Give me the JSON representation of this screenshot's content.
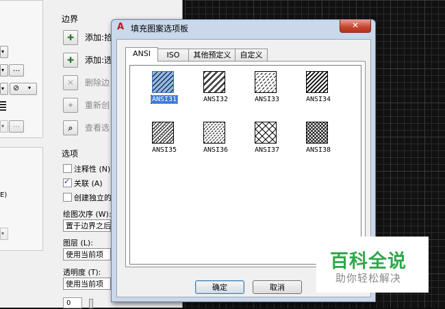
{
  "background_dialog": {
    "boundary_title": "边界",
    "boundary_buttons": [
      {
        "label": "添加:拾",
        "icon": "add-pick-points-icon",
        "enabled": true
      },
      {
        "label": "添加:选",
        "icon": "add-select-objects-icon",
        "enabled": true
      },
      {
        "label": "删除边",
        "icon": "remove-boundaries-icon",
        "enabled": false
      },
      {
        "label": "重新创",
        "icon": "recreate-boundary-icon",
        "enabled": false
      },
      {
        "label": "查看选",
        "icon": "view-selections-icon",
        "enabled": false
      }
    ],
    "options_title": "选项",
    "checkboxes": [
      {
        "label": "注释性 (N)",
        "checked": false
      },
      {
        "label": "关联 (A)",
        "checked": true
      },
      {
        "label": "创建独立的",
        "checked": false
      }
    ],
    "draw_order_label": "绘图次序 (W):",
    "draw_order_value": "置于边界之后",
    "layer_label": "图层 (L):",
    "layer_value": "使用当前项",
    "transparency_label": "透明度 (T):",
    "transparency_value": "使用当前项",
    "transparency_number": "0",
    "left_small_text": "E)",
    "ellipsis": "..."
  },
  "dialog": {
    "title": "填充图案选项板",
    "close_symbol": "✕",
    "tabs": [
      {
        "label": "ANSI",
        "active": true
      },
      {
        "label": "ISO",
        "active": false
      },
      {
        "label": "其他预定义",
        "active": false
      },
      {
        "label": "自定义",
        "active": false
      }
    ],
    "patterns": [
      {
        "name": "ANSI31",
        "selected": true,
        "style": "hatch-diag"
      },
      {
        "name": "ANSI32",
        "selected": false,
        "style": "hatch-diag-double"
      },
      {
        "name": "ANSI33",
        "selected": false,
        "style": "hatch-dash-diag"
      },
      {
        "name": "ANSI34",
        "selected": false,
        "style": "hatch-diag-heavy"
      },
      {
        "name": "ANSI35",
        "selected": false,
        "style": "hatch-diag-mixed"
      },
      {
        "name": "ANSI36",
        "selected": false,
        "style": "hatch-diag-dotted"
      },
      {
        "name": "ANSI37",
        "selected": false,
        "style": "crosshatch"
      },
      {
        "name": "ANSI38",
        "selected": false,
        "style": "crosshatch-dense"
      }
    ],
    "ok_label": "确定",
    "cancel_label": "取消"
  },
  "watermark": {
    "title": "百科全说",
    "subtitle": "助你轻松解决"
  },
  "colors": {
    "selection": "#3a78d8",
    "watermark_green": "#2ea84b",
    "cad_background": "#111111"
  }
}
